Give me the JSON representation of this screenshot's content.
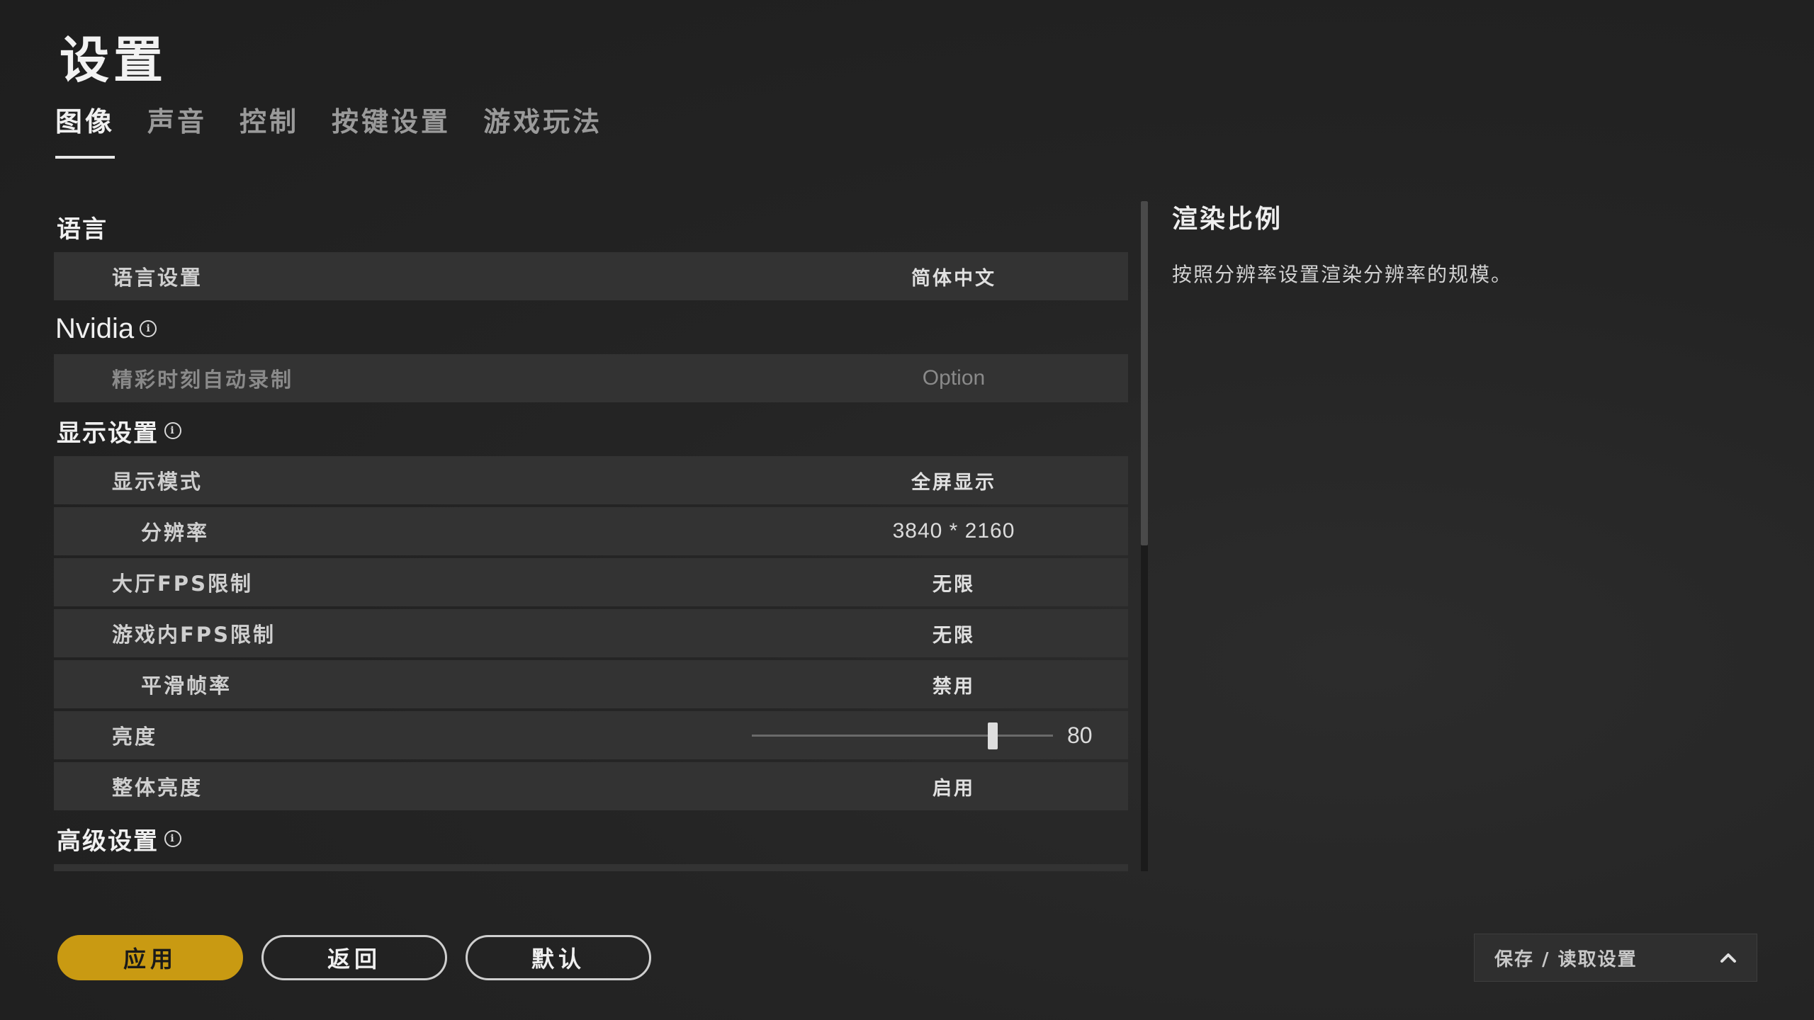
{
  "title": "设置",
  "tabs": [
    {
      "label": "图像",
      "active": true
    },
    {
      "label": "声音"
    },
    {
      "label": "控制"
    },
    {
      "label": "按键设置"
    },
    {
      "label": "游戏玩法"
    }
  ],
  "sections": {
    "language": {
      "title": "语言",
      "rows": [
        {
          "label": "语言设置",
          "value": "简体中文"
        }
      ]
    },
    "nvidia": {
      "title": "Nvidia",
      "rows": [
        {
          "label": "精彩时刻自动录制",
          "value": "Option"
        }
      ]
    },
    "display": {
      "title": "显示设置",
      "rows": [
        {
          "label": "显示模式",
          "value": "全屏显示"
        },
        {
          "label": "分辨率",
          "value": "3840 * 2160"
        },
        {
          "label": "大厅FPS限制",
          "value": "无限"
        },
        {
          "label": "游戏内FPS限制",
          "value": "无限"
        },
        {
          "label": "平滑帧率",
          "value": "禁用"
        },
        {
          "label": "亮度",
          "value": "80",
          "min": 0,
          "max": 100
        },
        {
          "label": "整体亮度",
          "value": "启用"
        }
      ]
    },
    "advanced": {
      "title": "高级设置"
    }
  },
  "description": {
    "title": "渲染比例",
    "text": "按照分辨率设置渲染分辨率的规模。"
  },
  "buttons": {
    "apply": "应用",
    "back": "返回",
    "default": "默认"
  },
  "save_load": {
    "label": "保存 / 读取设置",
    "icon": "chevron-up-icon"
  },
  "info_icon": "info-icon",
  "colors": {
    "accent": "#c99a12",
    "row_bg": "#333333",
    "background": "#242424"
  }
}
